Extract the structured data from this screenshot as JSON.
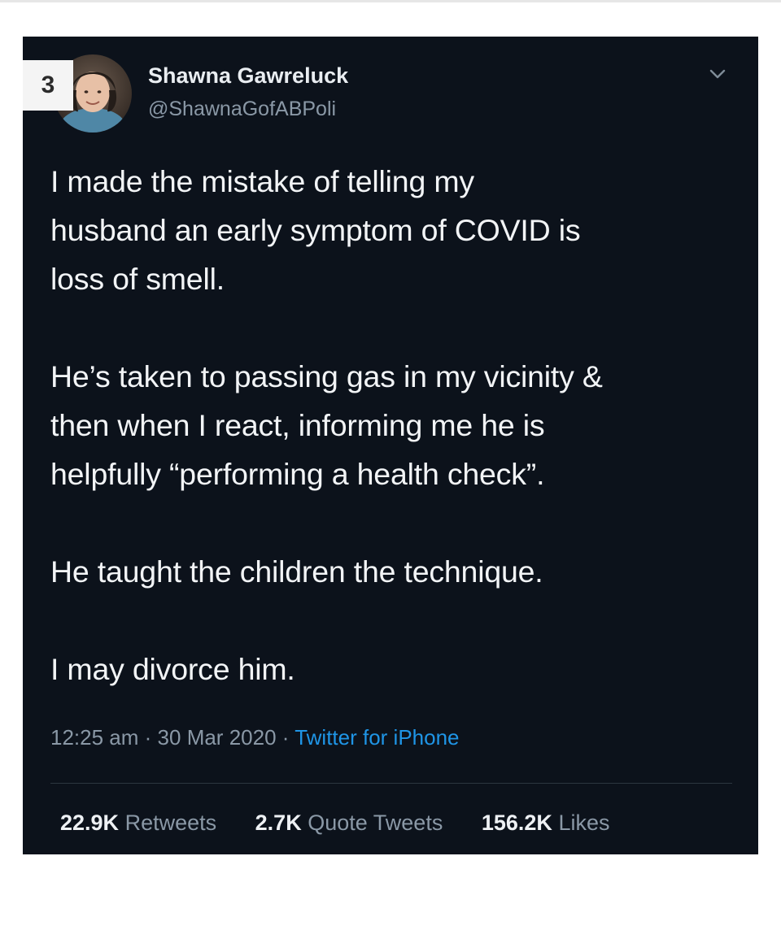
{
  "list_rank": "3",
  "tweet": {
    "author_name": "Shawna Gawreluck",
    "author_handle": "@ShawnaGofABPoli",
    "paragraphs": [
      "I made the mistake of telling my\nhusband an early symptom of COVID is\nloss of smell.",
      "He’s taken to passing gas in my vicinity &\nthen when I react, informing me he is\nhelpfully “performing a health check”.",
      "He taught the children the technique.",
      "I may divorce him."
    ],
    "time": "12:25 am",
    "date": "30 Mar 2020",
    "separator": "·",
    "source": "Twitter for iPhone",
    "stats": {
      "retweets_count": "22.9K",
      "retweets_label": "Retweets",
      "quotes_count": "2.7K",
      "quotes_label": "Quote Tweets",
      "likes_count": "156.2K",
      "likes_label": "Likes"
    }
  },
  "icons": {
    "menu": "chevron-down-icon",
    "avatar": "profile-photo"
  },
  "colors": {
    "card_background": "#0c121b",
    "primary_text": "#f2f4f6",
    "secondary_text": "#8a98a6",
    "link": "#1f95e6",
    "badge_background": "#f4f4f4"
  }
}
